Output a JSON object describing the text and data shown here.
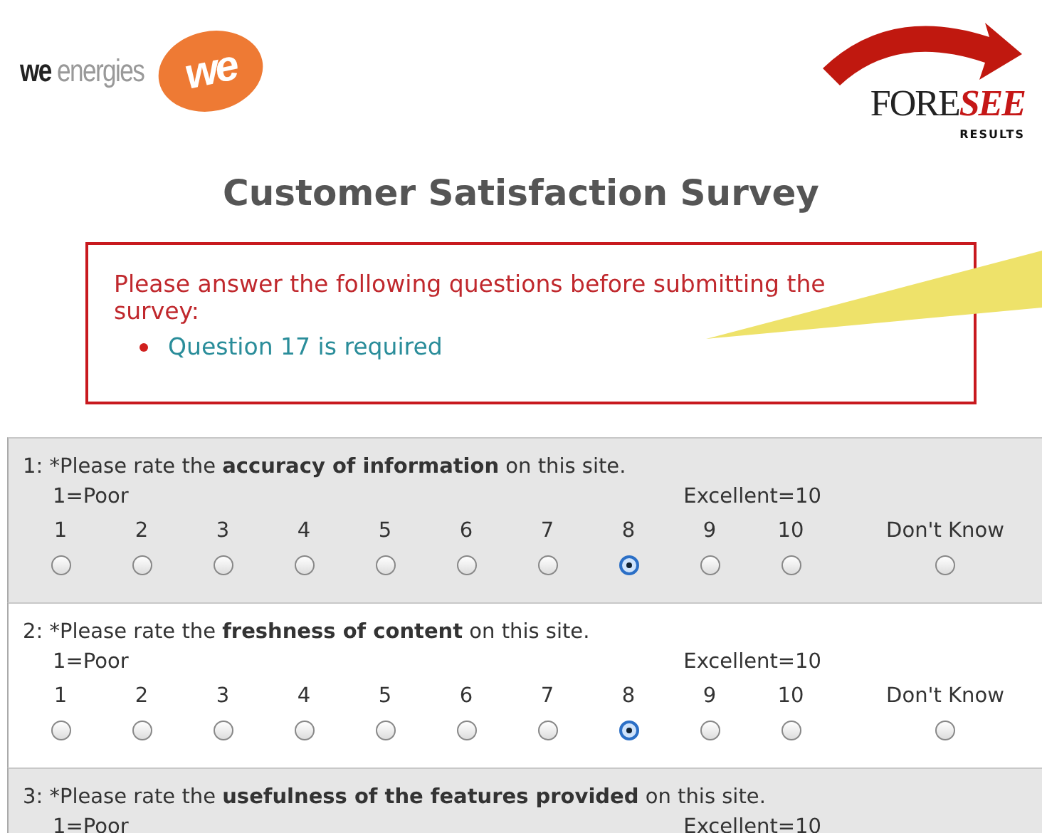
{
  "header": {
    "brand_logo": {
      "wordmark_bold": "we",
      "wordmark_light": "energies",
      "badge": "we"
    },
    "partner_logo": {
      "part_1": "FORE",
      "part_2": "SEE",
      "tagline": "RESULTS"
    }
  },
  "title": "Customer Satisfaction Survey",
  "error_box": {
    "message": "Please answer the following questions before submitting the survey:",
    "items": [
      "Question 17 is required"
    ]
  },
  "questions": [
    {
      "text": "1: *Please rate the **accuracy of information** on this site.",
      "low_label": "1=Poor",
      "high_label": "Excellent=10",
      "options": [
        {
          "label": "1",
          "selected": false
        },
        {
          "label": "2",
          "selected": false
        },
        {
          "label": "3",
          "selected": false
        },
        {
          "label": "4",
          "selected": false
        },
        {
          "label": "5",
          "selected": false
        },
        {
          "label": "6",
          "selected": false
        },
        {
          "label": "7",
          "selected": false
        },
        {
          "label": "8",
          "selected": true
        },
        {
          "label": "9",
          "selected": false
        },
        {
          "label": "10",
          "selected": false
        },
        {
          "label": "Don't Know",
          "selected": false
        }
      ]
    },
    {
      "text": "2: *Please rate the **freshness of content** on this site.",
      "low_label": "1=Poor",
      "high_label": "Excellent=10",
      "options": [
        {
          "label": "1",
          "selected": false
        },
        {
          "label": "2",
          "selected": false
        },
        {
          "label": "3",
          "selected": false
        },
        {
          "label": "4",
          "selected": false
        },
        {
          "label": "5",
          "selected": false
        },
        {
          "label": "6",
          "selected": false
        },
        {
          "label": "7",
          "selected": false
        },
        {
          "label": "8",
          "selected": true
        },
        {
          "label": "9",
          "selected": false
        },
        {
          "label": "10",
          "selected": false
        },
        {
          "label": "Don't Know",
          "selected": false
        }
      ]
    },
    {
      "text": "3: *Please rate the **usefulness of the features provided** on this site.",
      "low_label": "1=Poor",
      "high_label": "Excellent=10"
    }
  ]
}
